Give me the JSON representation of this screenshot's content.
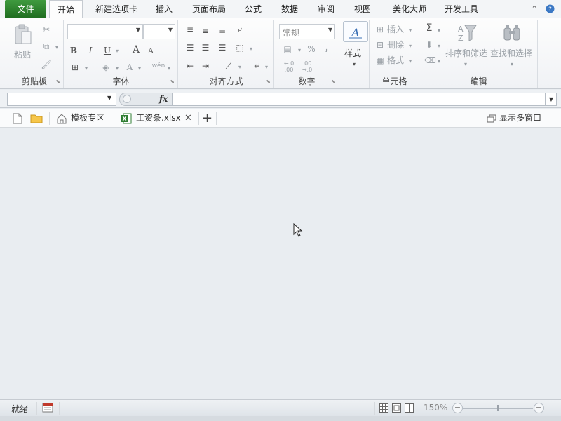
{
  "ribbon_tabs": [
    {
      "label": "文件"
    },
    {
      "label": "开始"
    },
    {
      "label": "新建选项卡"
    },
    {
      "label": "插入"
    },
    {
      "label": "页面布局"
    },
    {
      "label": "公式"
    },
    {
      "label": "数据"
    },
    {
      "label": "审阅"
    },
    {
      "label": "视图"
    },
    {
      "label": "美化大师"
    },
    {
      "label": "开发工具"
    }
  ],
  "ribbon": {
    "clipboard": {
      "label": "剪贴板",
      "paste": "粘贴"
    },
    "font": {
      "label": "字体",
      "bold": "B",
      "italic": "I",
      "underline": "U",
      "grow": "A",
      "shrink": "A",
      "color_a": "A",
      "wen": "wén"
    },
    "alignment": {
      "label": "对齐方式"
    },
    "number": {
      "label": "数字",
      "format_value": "常规",
      "percent": "%",
      "comma": ",",
      "inc_dec": "←.0 .00",
      "dec_dec": ".00 →.0"
    },
    "styles": {
      "label": "样式"
    },
    "cells": {
      "label": "单元格",
      "insert": "插入",
      "delete": "删除",
      "format": "格式"
    },
    "editing": {
      "label": "编辑",
      "sum": "Σ",
      "sort": "排序和筛选",
      "find": "查找和选择"
    }
  },
  "formula_bar": {
    "fx": "fx",
    "name_value": "",
    "formula_value": ""
  },
  "doc_tabs": {
    "template": "模板专区",
    "file": "工资条.xlsx",
    "close": "✕",
    "add": "+",
    "multi_window": "显示多窗口"
  },
  "statusbar": {
    "ready": "就绪",
    "zoom": "150%",
    "minus": "−",
    "plus": "+"
  },
  "colors": {
    "file_tab": "#2e7d32",
    "accent": "#1f6d1f"
  }
}
